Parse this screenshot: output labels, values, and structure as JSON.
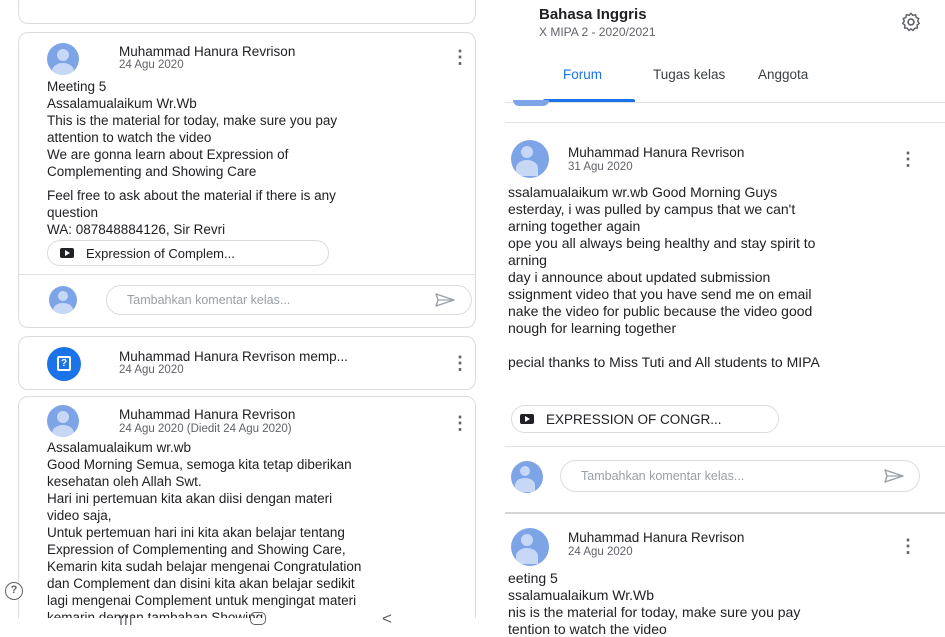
{
  "left": {
    "post1": {
      "author": "Muhammad Hanura Revrison",
      "date": "24 Agu 2020",
      "lines": [
        "Meeting 5",
        "Assalamualaikum Wr.Wb",
        "This is the material for today, make sure you pay",
        "attention to watch the video",
        "We are gonna learn about Expression of",
        "Complementing and Showing Care",
        "",
        "Feel free to ask about the material if there is any",
        "question",
        "WA: 087848884126, Sir Revri"
      ],
      "attachment": "Expression of Complem...",
      "comment_placeholder": "Tambahkan komentar kelas..."
    },
    "post2": {
      "author": "Muhammad Hanura Revrison memp...",
      "date": "24 Agu 2020"
    },
    "post3": {
      "author": "Muhammad Hanura Revrison",
      "date": "24 Agu 2020 (Diedit 24 Agu 2020)",
      "lines": [
        "Assalamualaikum wr.wb",
        "Good Morning Semua, semoga kita tetap diberikan",
        "kesehatan oleh Allah Swt.",
        "Hari ini pertemuan kita akan diisi dengan materi",
        "video saja,",
        "Untuk pertemuan hari ini kita akan belajar tentang",
        "Expression of Complementing and Showing Care,",
        "Kemarin kita sudah belajar mengenai Congratulation",
        "dan Complement dan disini kita akan belajar sedikit",
        "lagi mengenai Complement untuk mengingat materi",
        "kemarin dengan tambahan Showing"
      ]
    },
    "navbar": {
      "recents": "III",
      "home": "○",
      "back": "<"
    }
  },
  "right": {
    "header": {
      "class_name": "Bahasa Inggris",
      "class_section": "X MIPA 2 - 2020/2021"
    },
    "tabs": [
      {
        "label": "Forum"
      },
      {
        "label": "Tugas kelas"
      },
      {
        "label": "Anggota"
      }
    ],
    "post1": {
      "author": "Muhammad Hanura Revrison",
      "date": "31 Agu 2020",
      "lines": [
        "ssalamualaikum wr.wb Good Morning Guys",
        "esterday, i was pulled by campus that we can't",
        "arning together again",
        "ope you all always being healthy and stay spirit to",
        "arning",
        "day i announce about updated submission",
        "ssignment video that you have send me on email",
        "nake the video for public because the video good",
        "nough for learning together",
        "",
        "pecial thanks to Miss Tuti and All students to MIPA"
      ],
      "attachment": "EXPRESSION OF CONGR...",
      "comment_placeholder": "Tambahkan komentar kelas..."
    },
    "post2": {
      "author": "Muhammad Hanura Revrison",
      "date": "24 Agu 2020",
      "lines": [
        "eeting 5",
        "ssalamualaikum Wr.Wb",
        "nis is the material for today, make sure you pay",
        "tention to watch the video"
      ]
    }
  },
  "colors": {
    "accent": "#1a73e8",
    "avatar": "#7ea4e8",
    "border": "#dadce0",
    "muted": "#5f6368"
  },
  "icons": [
    "settings-icon",
    "kebab-menu-icon",
    "youtube-icon",
    "send-icon",
    "assignment-icon",
    "help-icon"
  ]
}
